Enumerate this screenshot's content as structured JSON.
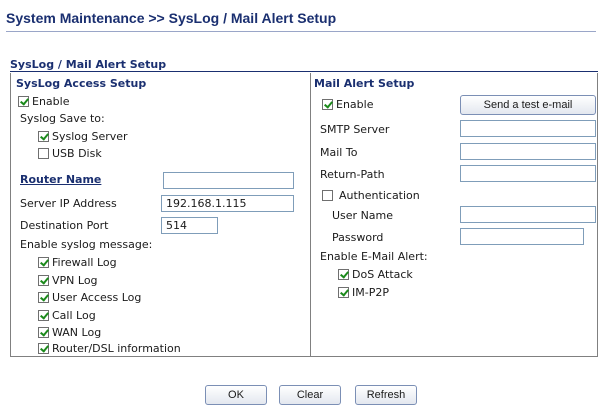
{
  "header": {
    "title": "System Maintenance >> SysLog / Mail Alert Setup"
  },
  "section_title": "SysLog / Mail Alert Setup",
  "syslog": {
    "heading": "SysLog Access Setup",
    "enable_label": "Enable",
    "enable_checked": true,
    "save_to_label": "Syslog Save to:",
    "syslog_server_label": "Syslog Server",
    "syslog_server_checked": true,
    "usb_disk_label": "USB Disk",
    "usb_disk_checked": false,
    "router_name_label": "Router Name",
    "router_name_value": "",
    "server_ip_label": "Server IP Address",
    "server_ip_value": "192.168.1.115",
    "dest_port_label": "Destination Port",
    "dest_port_value": "514",
    "messages_label": "Enable syslog message:",
    "messages": [
      {
        "label": "Firewall Log",
        "checked": true
      },
      {
        "label": "VPN Log",
        "checked": true
      },
      {
        "label": "User Access Log",
        "checked": true
      },
      {
        "label": "Call Log",
        "checked": true
      },
      {
        "label": "WAN Log",
        "checked": true
      },
      {
        "label": "Router/DSL information",
        "checked": true
      }
    ]
  },
  "mail": {
    "heading": "Mail Alert Setup",
    "enable_label": "Enable",
    "enable_checked": true,
    "test_button_label": "Send a test e-mail",
    "smtp_label": "SMTP Server",
    "smtp_value": "",
    "mail_to_label": "Mail To",
    "mail_to_value": "",
    "return_path_label": "Return-Path",
    "return_path_value": "",
    "auth_label": "Authentication",
    "auth_checked": false,
    "user_name_label": "User Name",
    "user_name_value": "",
    "password_label": "Password",
    "password_value": "",
    "alert_label": "Enable E-Mail Alert:",
    "alerts": [
      {
        "label": "DoS Attack",
        "checked": true
      },
      {
        "label": "IM-P2P",
        "checked": true
      }
    ]
  },
  "footer": {
    "ok_label": "OK",
    "clear_label": "Clear",
    "refresh_label": "Refresh"
  }
}
